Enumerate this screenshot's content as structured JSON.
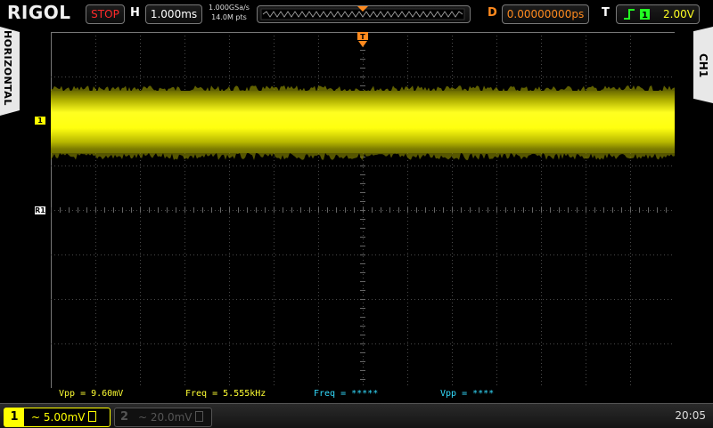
{
  "brand": "RIGOL",
  "status": "STOP",
  "horizontal": {
    "label": "H",
    "timebase": "1.000ms",
    "sample_rate": "1.000GSa/s",
    "memory_depth": "14.0M pts"
  },
  "delay": {
    "label": "D",
    "value": "0.00000000ps"
  },
  "trigger": {
    "label": "T",
    "level": "2.00V",
    "source_marker": "1",
    "mode_icon": "rising-edge-icon"
  },
  "left_tab": "HORIZONTAL",
  "right_tab": "CH1",
  "markers": {
    "ch1": "1",
    "ref1": "R1"
  },
  "measurements": [
    {
      "text": "Vpp = 9.60mV",
      "color": "#ffff33"
    },
    {
      "text": "Freq = 5.555kHz",
      "color": "#ffff33"
    },
    {
      "text": "Freq = *****",
      "color": "#33ddff"
    },
    {
      "text": "Vpp = ****",
      "color": "#33ddff"
    }
  ],
  "channels": [
    {
      "number": "1",
      "coupling": "~",
      "scale": "5.00mV",
      "color": "#ffff00"
    },
    {
      "number": "2",
      "coupling": "~",
      "scale": "20.0mV",
      "color": "#555555"
    }
  ],
  "time": "20:05",
  "colors": {
    "trigger": "#ff8a1e",
    "ch1": "#ffff00",
    "stop": "#ff2a2a"
  }
}
